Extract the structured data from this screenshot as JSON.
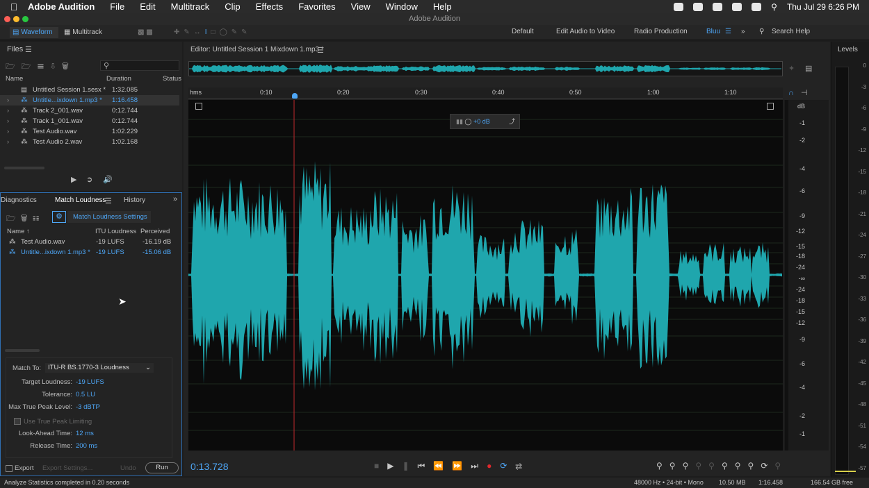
{
  "menubar": {
    "app": "Adobe Audition",
    "items": [
      "File",
      "Edit",
      "Multitrack",
      "Clip",
      "Effects",
      "Favorites",
      "View",
      "Window",
      "Help"
    ],
    "clock": "Thu Jul 29  6:26 PM"
  },
  "window": {
    "title": "Adobe Audition"
  },
  "toolbar": {
    "waveform": "Waveform",
    "multitrack": "Multitrack",
    "workspaces": [
      "Default",
      "Edit Audio to Video",
      "Radio Production",
      "Bluu"
    ],
    "search": "Search Help"
  },
  "files": {
    "title": "Files",
    "col_name": "Name",
    "col_duration": "Duration",
    "col_status": "Status",
    "rows": [
      {
        "name": "Untitled Session 1.sesx *",
        "duration": "1:32.085"
      },
      {
        "name": "Untitle...ixdown 1.mp3 *",
        "duration": "1:16.458"
      },
      {
        "name": "Track 2_001.wav",
        "duration": "0:12.744"
      },
      {
        "name": "Track 1_001.wav",
        "duration": "0:12.744"
      },
      {
        "name": "Test Audio.wav",
        "duration": "1:02.229"
      },
      {
        "name": "Test Audio 2.wav",
        "duration": "1:02.168"
      }
    ]
  },
  "match": {
    "tab_diag": "Diagnostics",
    "tab_match": "Match Loudness",
    "tab_history": "History",
    "settings": "Match Loudness Settings",
    "col_name": "Name",
    "col_itu": "ITU Loudness",
    "col_perc": "Perceived",
    "rows": [
      {
        "name": "Test Audio.wav",
        "itu": "-19 LUFS",
        "perceived": "-16.19 dB"
      },
      {
        "name": "Untitle...ixdown 1.mp3 *",
        "itu": "-19 LUFS",
        "perceived": "-15.06 dB"
      }
    ],
    "match_to_label": "Match To:",
    "match_to": "ITU-R BS.1770-3 Loudness",
    "target_label": "Target Loudness:",
    "target": "-19 LUFS",
    "tol_label": "Tolerance:",
    "tol": "0.5 LU",
    "peak_label": "Max True Peak Level:",
    "peak": "-3 dBTP",
    "use_peak": "Use True Peak Limiting",
    "look_label": "Look-Ahead Time:",
    "look": "12 ms",
    "release_label": "Release Time:",
    "release": "200 ms",
    "export": "Export",
    "export_settings": "Export Settings...",
    "undo": "Undo",
    "run": "Run"
  },
  "editor": {
    "title": "Editor: Untitled Session 1 Mixdown 1.mp3 *",
    "time": "0:13.728",
    "gain": "+0 dB",
    "ruler_unit": "hms",
    "ticks": [
      "0:10",
      "0:20",
      "0:30",
      "0:40",
      "0:50",
      "1:00",
      "1:10"
    ],
    "db_unit": "dB",
    "db_labels": [
      "-1",
      "-2",
      "-4",
      "-6",
      "-9",
      "-12",
      "-15",
      "-18",
      "-24",
      "-∞",
      "-24",
      "-18",
      "-15",
      "-12",
      "-9",
      "-6",
      "-4",
      "-2",
      "-1"
    ],
    "waveform_color": "#1fa6ad"
  },
  "levels": {
    "title": "Levels",
    "scale": [
      "0",
      "-3",
      "-6",
      "-9",
      "-12",
      "-15",
      "-18",
      "-21",
      "-24",
      "-27",
      "-30",
      "-33",
      "-36",
      "-39",
      "-42",
      "-45",
      "-48",
      "-51",
      "-54",
      "-57"
    ]
  },
  "status": {
    "left": "Analyze Statistics completed in 0.20 seconds",
    "rate": "48000 Hz • 24-bit • Mono",
    "size": "10.50 MB",
    "dur": "1:16.458",
    "free": "166.54 GB free"
  }
}
